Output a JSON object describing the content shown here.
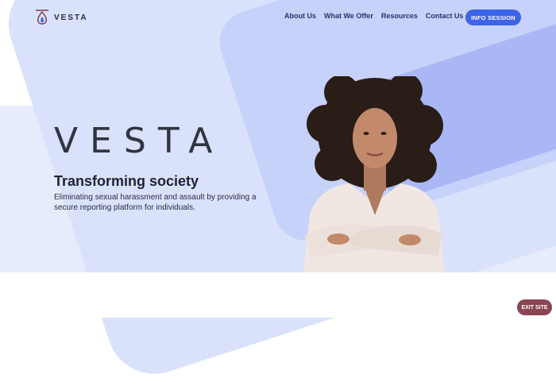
{
  "brand": {
    "name": "VESTA"
  },
  "nav": {
    "items": [
      {
        "label": "About Us"
      },
      {
        "label": "What We Offer"
      },
      {
        "label": "Resources"
      },
      {
        "label": "Contact Us"
      }
    ],
    "cta_label": "INFO SESSION"
  },
  "hero": {
    "logo_text": "VESTA",
    "title": "Transforming society",
    "subtitle": "Eliminating sexual harassment and assault by providing a secure reporting platform for individuals."
  },
  "exit_label": "EXIT SITE",
  "colors": {
    "accent": "#3c63e8",
    "exit": "#8a4452",
    "text_dark": "#2f3540",
    "nav": "#27336b"
  }
}
